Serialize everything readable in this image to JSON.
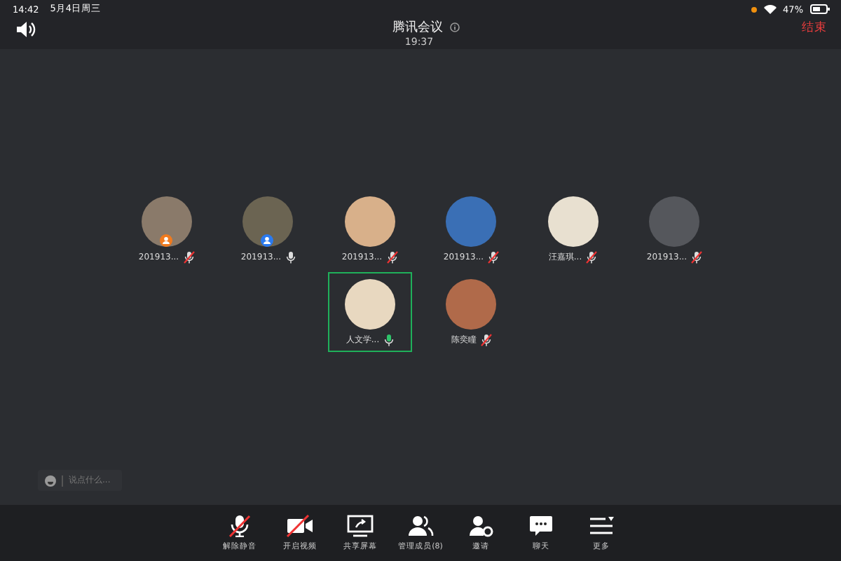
{
  "status_bar": {
    "time": "14:42",
    "date": "5月4日周三",
    "battery": "47%"
  },
  "header": {
    "title": "腾讯会议",
    "duration": "19:37",
    "end_button": "结束"
  },
  "participants": [
    {
      "name": "201913...",
      "muted": true,
      "speaking": false,
      "host": true,
      "cohost": false,
      "selected": false
    },
    {
      "name": "201913...",
      "muted": false,
      "speaking": false,
      "host": false,
      "cohost": true,
      "selected": false
    },
    {
      "name": "201913...",
      "muted": true,
      "speaking": false,
      "host": false,
      "cohost": false,
      "selected": false
    },
    {
      "name": "201913...",
      "muted": true,
      "speaking": false,
      "host": false,
      "cohost": false,
      "selected": false
    },
    {
      "name": "汪嘉琪...",
      "muted": true,
      "speaking": false,
      "host": false,
      "cohost": false,
      "selected": false
    },
    {
      "name": "201913...",
      "muted": true,
      "speaking": false,
      "host": false,
      "cohost": false,
      "selected": false
    },
    {
      "name": "人文学...",
      "muted": false,
      "speaking": true,
      "host": false,
      "cohost": false,
      "selected": true
    },
    {
      "name": "陈奕瞳",
      "muted": true,
      "speaking": false,
      "host": false,
      "cohost": false,
      "selected": false
    }
  ],
  "chat_input": {
    "placeholder": "说点什么..."
  },
  "toolbar": [
    {
      "label": "解除静音",
      "kind": "mic-off"
    },
    {
      "label": "开启视频",
      "kind": "video-off"
    },
    {
      "label": "共享屏幕",
      "kind": "share"
    },
    {
      "label": "管理成员(8)",
      "kind": "members"
    },
    {
      "label": "邀请",
      "kind": "invite"
    },
    {
      "label": "聊天",
      "kind": "chat"
    },
    {
      "label": "更多",
      "kind": "more"
    }
  ]
}
